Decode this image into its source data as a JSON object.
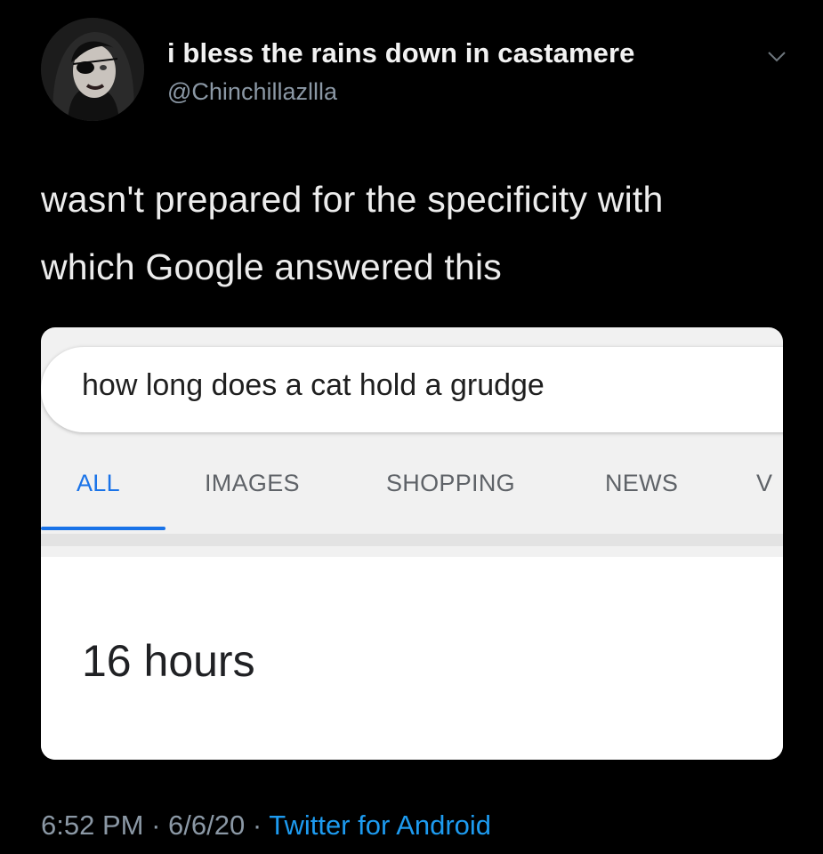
{
  "tweet": {
    "display_name": "i bless the rains down in castamere",
    "handle": "@Chinchillazllla",
    "text_line1": "wasn't prepared for the specificity with",
    "text_line2": "which Google answered this",
    "menu_icon": "chevron-down-icon"
  },
  "search_card": {
    "query": "how long does a cat hold a grudge",
    "tabs": [
      {
        "label": "ALL",
        "active": true
      },
      {
        "label": "IMAGES",
        "active": false
      },
      {
        "label": "SHOPPING",
        "active": false
      },
      {
        "label": "NEWS",
        "active": false
      },
      {
        "label": "V",
        "active": false
      }
    ],
    "answer": "16 hours",
    "accent_color": "#1a73e8"
  },
  "footer": {
    "time": "6:52 PM",
    "separator": " · ",
    "date": "6/6/20",
    "source": "Twitter for Android"
  }
}
